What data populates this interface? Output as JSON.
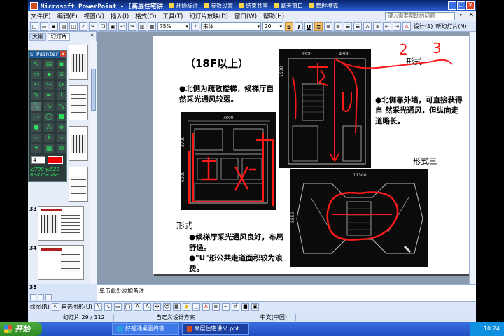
{
  "window": {
    "title": "Microsoft PowerPoint - [高层住宅讲",
    "tools": [
      "开始标注",
      "参数设置",
      "结束共享",
      "聊天窗口",
      "管理模式"
    ]
  },
  "menu": {
    "items": [
      "文件(F)",
      "编辑(E)",
      "视图(V)",
      "插入(I)",
      "格式(O)",
      "工具(T)",
      "幻灯片放映(D)",
      "窗口(W)",
      "帮助(H)"
    ],
    "help_placeholder": "键入需要帮助的问题"
  },
  "toolbar": {
    "zoom": "75%",
    "font": "宋体",
    "size": "20",
    "design": "设计(S)",
    "new_slide": "新幻灯片(N)"
  },
  "panel": {
    "tabs": [
      "大纲",
      "幻灯片"
    ],
    "thumbs": [
      "33",
      "34",
      "35"
    ]
  },
  "painter": {
    "title": "E Painter",
    "width": "4",
    "coord": "x/798  y/529",
    "color_name": "Red Candle",
    "color": "#e00000"
  },
  "slide": {
    "title": "（18F以上）",
    "north_text": "●北侧为疏散楼梯，候梯厅自然采光通风较弱。",
    "form2_label": "形式二",
    "form2_desc": "●北侧靠外墙，可直接获得自 然采光通风，但纵向走道略长。",
    "form3_label": "形式三",
    "form1_label": "形式一",
    "form1_desc1": "●候梯厅采光通风良好，布局舒适。",
    "form1_desc2": "●\"U\"形公共走道面积较为浪费。",
    "dims": {
      "plan1_top": "7800",
      "plan1_side_a": "2700",
      "plan1_side_b": "6000",
      "plan2_top_a": "3300",
      "plan2_top_b": "4300",
      "plan2_side": "1500",
      "plan3_top": "11300",
      "plan3_side": "8850"
    },
    "annotations": [
      "2",
      "3"
    ]
  },
  "notes": {
    "text": "单击此处添加备注"
  },
  "drawbar": {
    "draw": "绘图(R)",
    "autoshapes": "自选图形(U)"
  },
  "status": {
    "slide_pos": "幻灯片 29 / 112",
    "design": "自定义设计方案",
    "language": "中文(中国)"
  },
  "taskbar": {
    "start": "开始",
    "items": [
      "好视通桌面终端",
      "高层住宅讲义.ppt..."
    ],
    "time": "10:24"
  }
}
